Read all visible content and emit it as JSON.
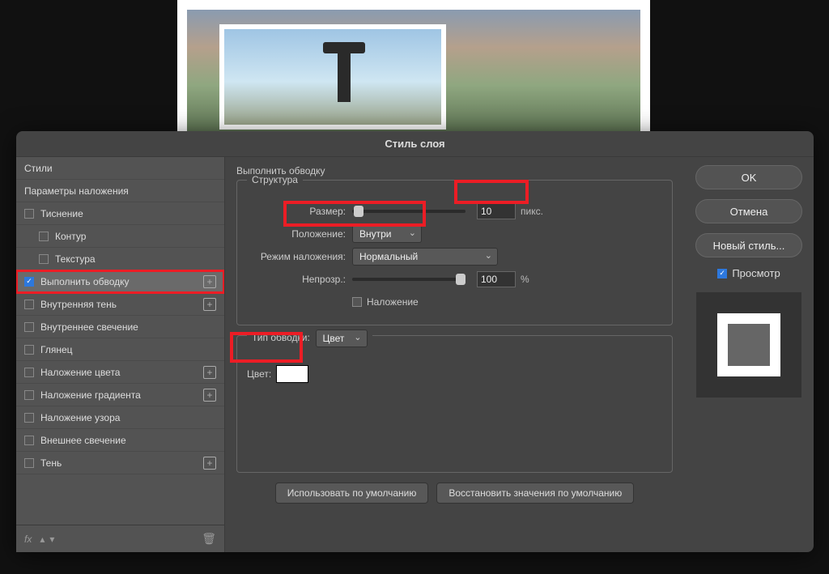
{
  "dialog": {
    "title": "Стиль слоя"
  },
  "sidebar": {
    "styles_header": "Стили",
    "blending_header": "Параметры наложения",
    "items": [
      {
        "label": "Тиснение",
        "has_add": false,
        "checked": false
      },
      {
        "label": "Контур",
        "sub": true
      },
      {
        "label": "Текстура",
        "sub": true
      },
      {
        "label": "Выполнить обводку",
        "has_add": true,
        "checked": true,
        "selected": true,
        "highlight": true
      },
      {
        "label": "Внутренняя тень",
        "has_add": true
      },
      {
        "label": "Внутреннее свечение"
      },
      {
        "label": "Глянец"
      },
      {
        "label": "Наложение цвета",
        "has_add": true
      },
      {
        "label": "Наложение градиента",
        "has_add": true
      },
      {
        "label": "Наложение узора"
      },
      {
        "label": "Внешнее свечение"
      },
      {
        "label": "Тень",
        "has_add": true
      }
    ],
    "footer_fx": "fx"
  },
  "panel": {
    "title": "Выполнить обводку",
    "group_structure": "Структура",
    "size_label": "Размер:",
    "size_value": "10",
    "size_unit": "пикс.",
    "position_label": "Положение:",
    "position_value": "Внутри",
    "blend_label": "Режим наложения:",
    "blend_value": "Нормальный",
    "opacity_label": "Непрозр.:",
    "opacity_value": "100",
    "opacity_unit": "%",
    "overprint_label": "Наложение",
    "stroketype_label": "Тип обводки:",
    "stroketype_value": "Цвет",
    "color_label": "Цвет:",
    "color_value": "#FFFFFF",
    "btn_default": "Использовать по умолчанию",
    "btn_reset": "Восстановить значения по умолчанию"
  },
  "right": {
    "ok": "OK",
    "cancel": "Отмена",
    "newstyle": "Новый стиль...",
    "preview": "Просмотр"
  }
}
